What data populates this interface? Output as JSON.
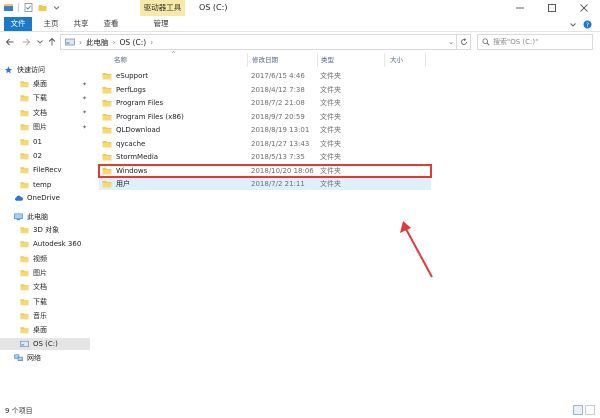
{
  "window": {
    "title": "OS (C:)",
    "context_tab": "驱动器工具",
    "buttons": [
      "minimize-icon",
      "maximize-icon",
      "close-icon"
    ]
  },
  "ribbon": {
    "tabs": {
      "file": "文件",
      "home": "主页",
      "share": "共享",
      "view": "查看",
      "manage": "管理"
    }
  },
  "address": {
    "segments": [
      "此电脑",
      "OS (C:)"
    ],
    "search_placeholder": "搜索\"OS (C:)\""
  },
  "navpane": {
    "quick_access": "快速访问",
    "items": [
      {
        "label": "桌面",
        "icon": "desktop-icon",
        "pinned": true
      },
      {
        "label": "下载",
        "icon": "download-icon",
        "pinned": true
      },
      {
        "label": "文档",
        "icon": "documents-icon",
        "pinned": true
      },
      {
        "label": "图片",
        "icon": "pictures-icon",
        "pinned": true
      },
      {
        "label": "01",
        "icon": "folder-icon"
      },
      {
        "label": "02",
        "icon": "folder-icon"
      },
      {
        "label": "FileRecv",
        "icon": "folder-icon"
      },
      {
        "label": "temp",
        "icon": "folder-icon"
      }
    ],
    "onedrive": "OneDrive",
    "this_pc": "此电脑",
    "pc_items": [
      {
        "label": "3D 对象",
        "icon": "3d-objects-icon"
      },
      {
        "label": "Autodesk 360",
        "icon": "autodesk-icon"
      },
      {
        "label": "视频",
        "icon": "videos-icon"
      },
      {
        "label": "图片",
        "icon": "pictures-icon"
      },
      {
        "label": "文档",
        "icon": "documents-icon"
      },
      {
        "label": "下载",
        "icon": "download-icon"
      },
      {
        "label": "音乐",
        "icon": "music-icon"
      },
      {
        "label": "桌面",
        "icon": "desktop-icon"
      },
      {
        "label": "OS (C:)",
        "icon": "drive-icon"
      }
    ],
    "network": "网络"
  },
  "columns": {
    "name": "名称",
    "date": "修改日期",
    "type": "类型",
    "size": "大小"
  },
  "files": [
    {
      "name": "eSupport",
      "date": "2017/6/15 4:46",
      "type": "文件夹"
    },
    {
      "name": "PerfLogs",
      "date": "2018/4/12 7:38",
      "type": "文件夹"
    },
    {
      "name": "Program Files",
      "date": "2018/7/2 21:08",
      "type": "文件夹"
    },
    {
      "name": "Program Files (x86)",
      "date": "2018/9/7 20:59",
      "type": "文件夹"
    },
    {
      "name": "QLDownload",
      "date": "2018/8/19 13:01",
      "type": "文件夹"
    },
    {
      "name": "qycache",
      "date": "2018/1/27 13:43",
      "type": "文件夹"
    },
    {
      "name": "StormMedia",
      "date": "2018/5/13 7:35",
      "type": "文件夹"
    },
    {
      "name": "Windows",
      "date": "2018/10/20 18:06",
      "type": "文件夹"
    },
    {
      "name": "用户",
      "date": "2018/7/2 21:11",
      "type": "文件夹"
    }
  ],
  "status": {
    "count": "9 个项目"
  },
  "colors": {
    "accent": "#1979ca",
    "context_tab": "#f7e9a8",
    "folder": "#f3c94f",
    "annotation": "#e13a3a",
    "row_hover": "#dff0fd"
  }
}
